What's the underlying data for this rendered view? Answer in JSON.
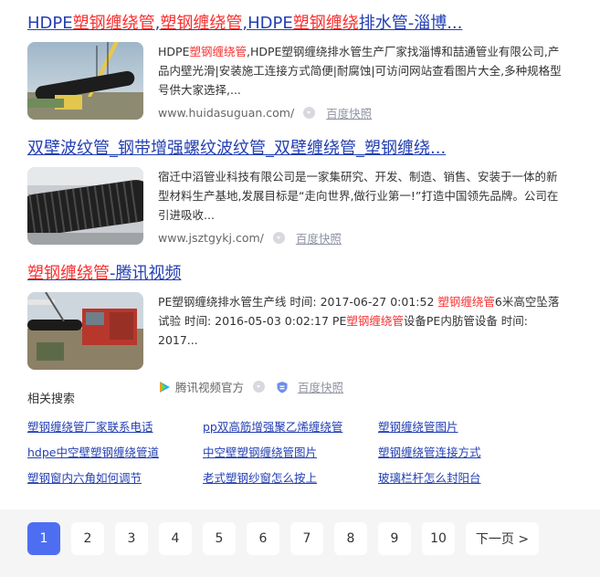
{
  "results": [
    {
      "title_parts": [
        {
          "text": "HDPE",
          "hl": false
        },
        {
          "text": "塑钢缠绕管",
          "hl": true
        },
        {
          "text": ",",
          "hl": false
        },
        {
          "text": "塑钢缠绕管",
          "hl": true
        },
        {
          "text": ",HDPE",
          "hl": false
        },
        {
          "text": "塑钢缠绕",
          "hl": true
        },
        {
          "text": "排水管-淄博...",
          "hl": false
        }
      ],
      "abstract_parts": [
        {
          "text": "HDPE",
          "hl": false
        },
        {
          "text": "塑钢缠绕管",
          "hl": true
        },
        {
          "text": ",HDPE塑钢缠绕排水管生产厂家找淄博和喆通管业有限公司,产品内壁光滑|安装施工连接方式简便|耐腐蚀|可访问网站查看图片大全,多种规格型号供大家选择,...",
          "hl": false
        }
      ],
      "url": "www.huidasuguan.com/",
      "snapshot": "百度快照"
    },
    {
      "title_parts": [
        {
          "text": "双壁波纹管_钢带增强螺纹波纹管_双壁缠绕管_塑钢缠绕...",
          "hl": false
        }
      ],
      "abstract_parts": [
        {
          "text": "宿迁中滔管业科技有限公司是一家集研究、开发、制造、销售、安装于一体的新型材料生产基地,发展目标是“走向世界,做行业第一!”打造中国领先品牌。公司在引进吸收...",
          "hl": false
        }
      ],
      "url": "www.jsztgykj.com/",
      "snapshot": "百度快照"
    },
    {
      "title_parts": [
        {
          "text": "塑钢缠绕管",
          "hl": true
        },
        {
          "text": "-腾讯视频",
          "hl": false
        }
      ],
      "abstract_parts": [
        {
          "text": "PE塑钢缠绕排水管生产线 时间: 2017-06-27 0:01:52 ",
          "hl": false
        },
        {
          "text": "塑钢缠绕管",
          "hl": true
        },
        {
          "text": "6米高空坠落试验 时间: 2016-05-03 0:02:17 PE",
          "hl": false
        },
        {
          "text": "塑钢缠绕管",
          "hl": true
        },
        {
          "text": "设备PE内肪管设备 时间: 2017...",
          "hl": false
        }
      ],
      "source": "腾讯视频官方",
      "snapshot": "百度快照"
    }
  ],
  "related": {
    "heading": "相关搜索",
    "items": [
      "塑钢缠绕管厂家联系电话",
      "pp双高筋增强聚乙烯缠绕管",
      "塑钢缠绕管图片",
      "hdpe中空壁塑钢缠绕管道",
      "中空壁塑钢缠绕管图片",
      "塑钢缠绕管连接方式",
      "塑钢窗内六角如何调节",
      "老式塑钢纱窗怎么按上",
      "玻璃栏杆怎么封阳台"
    ]
  },
  "pagination": {
    "pages": [
      "1",
      "2",
      "3",
      "4",
      "5",
      "6",
      "7",
      "8",
      "9",
      "10"
    ],
    "current": "1",
    "next_label": "下一页 >"
  },
  "colors": {
    "link": "#2440b3",
    "highlight": "#f73131",
    "active_page": "#4e6ef2"
  }
}
